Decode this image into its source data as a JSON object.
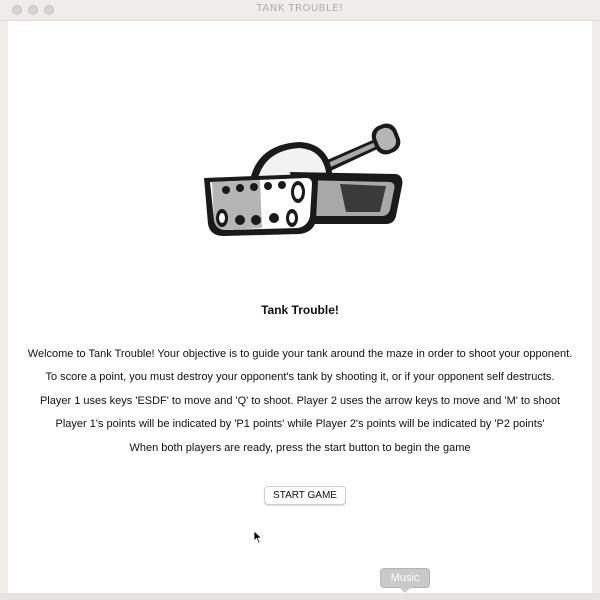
{
  "window": {
    "title": "TANK TROUBLE!"
  },
  "game": {
    "heading": "Tank Trouble!",
    "instructions": [
      "Welcome to Tank Trouble! Your objective is to guide your tank around the maze in order to shoot your opponent.",
      "To score a point, you must destroy your opponent's tank by shooting it, or if your opponent self destructs.",
      "Player 1 uses keys 'ESDF' to move and 'Q' to shoot. Player 2 uses the arrow keys to move and 'M' to shoot",
      "Player 1's points will be indicated by 'P1 points' while Player 2's points will be indicated by 'P2 points'",
      "When both players are ready, press the start button to begin the game"
    ],
    "start_button_label": "START GAME",
    "logo_icon": "tank-icon"
  },
  "dock": {
    "tooltip": "Music"
  },
  "colors": {
    "titlebar": "#f0ecea",
    "tank_dark": "#1a1a1a",
    "tank_light": "#a8a8a8",
    "tooltip": "#c9c9c9"
  }
}
